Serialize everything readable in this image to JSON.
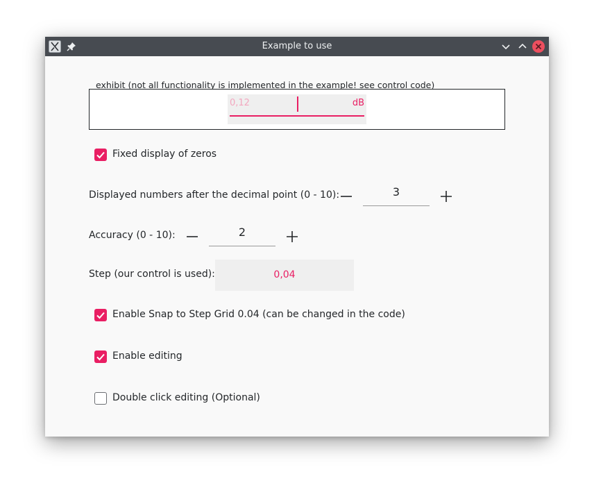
{
  "window": {
    "title": "Example to use",
    "icons": {
      "app": "app-icon",
      "pin": "pin-icon",
      "minimize": "chevron-down-icon",
      "maximize": "chevron-up-icon",
      "close": "close-icon"
    }
  },
  "exhibit": {
    "label": "exhibit (not all functionality is implemented in the example! see control code)",
    "value": "0,12",
    "unit": "dB"
  },
  "fixed_zeros": {
    "label": "Fixed display of zeros",
    "checked": true
  },
  "decimals": {
    "label": "Displayed numbers after the decimal point (0 - 10):",
    "value": "3",
    "minus_icon": "minus-icon",
    "plus_icon": "plus-icon"
  },
  "accuracy": {
    "label": "Accuracy (0 - 10):",
    "value": "2",
    "minus_icon": "minus-icon",
    "plus_icon": "plus-icon"
  },
  "step": {
    "label": "Step (our control is used):",
    "value": "0,04"
  },
  "snap": {
    "label": "Enable Snap to Step Grid 0.04 (can be changed in the code)",
    "checked": true
  },
  "editing": {
    "label": "Enable editing",
    "checked": true
  },
  "double_click": {
    "label": "Double click editing (Optional)",
    "checked": false
  },
  "colors": {
    "accent": "#e91e63",
    "titlebar": "#474b51",
    "background": "#f9f9f9",
    "close": "#ed4f5f"
  }
}
